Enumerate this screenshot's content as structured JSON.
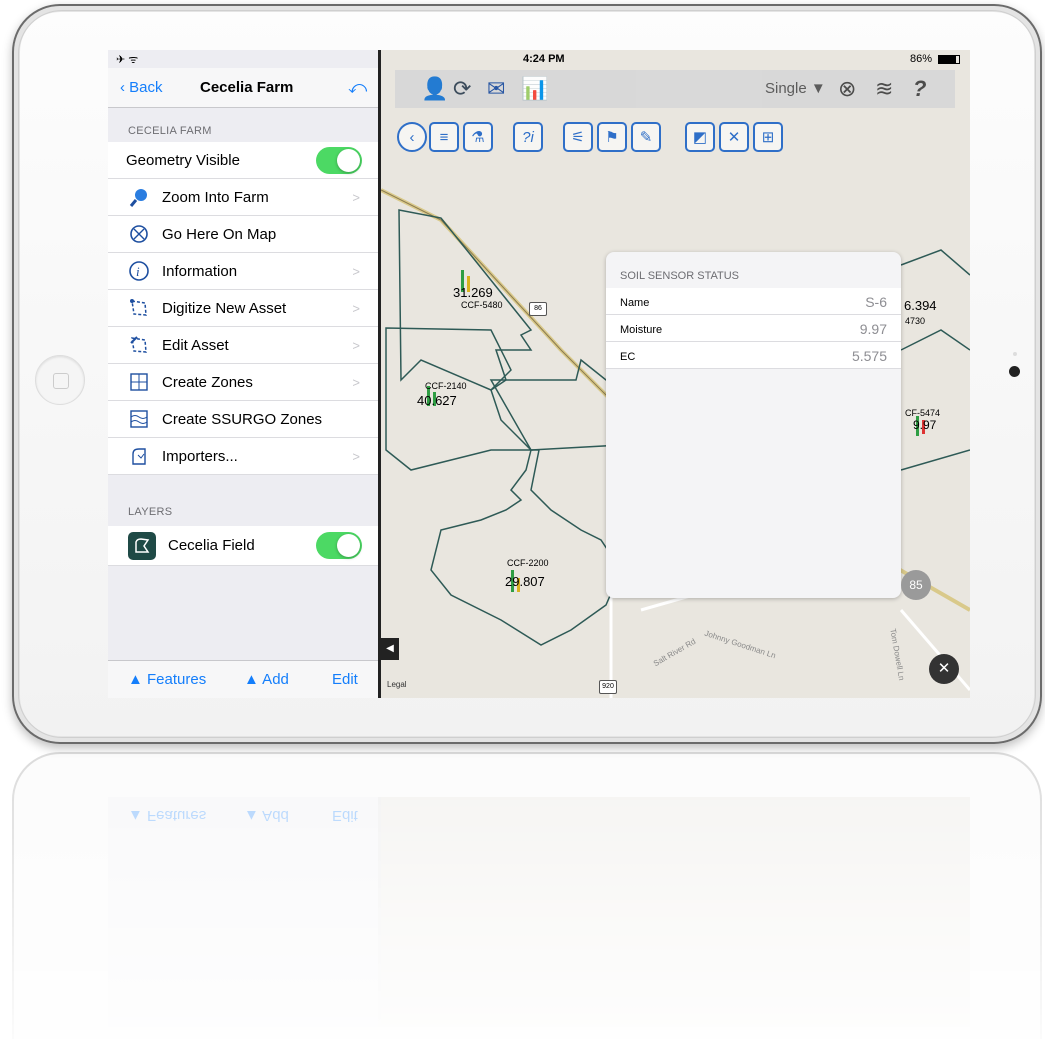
{
  "status_bar": {
    "left_icons": "✈ ᯤ",
    "time": "4:24 PM",
    "battery": "86%"
  },
  "nav": {
    "back_label": "Back",
    "title": "Cecelia Farm"
  },
  "sections": {
    "farm_header": "CECELIA FARM",
    "layers_header": "LAYERS"
  },
  "farm_items": [
    {
      "label": "Geometry Visible",
      "type": "toggle"
    },
    {
      "label": "Zoom Into Farm",
      "icon": "magnifier-icon"
    },
    {
      "label": "Go Here On Map",
      "icon": "compass-icon"
    },
    {
      "label": "Information",
      "icon": "info-icon"
    },
    {
      "label": "Digitize New Asset",
      "icon": "digitize-icon"
    },
    {
      "label": "Edit Asset",
      "icon": "edit-asset-icon"
    },
    {
      "label": "Create Zones",
      "icon": "grid-icon"
    },
    {
      "label": "Create SSURGO Zones",
      "icon": "ssurgo-icon"
    },
    {
      "label": "Importers...",
      "icon": "importer-icon"
    }
  ],
  "layers": [
    {
      "label": "Cecelia Field",
      "toggle": true
    }
  ],
  "bottom_bar": {
    "features": "▲ Features",
    "add": "▲ Add",
    "edit": "Edit"
  },
  "map_toolbar": {
    "mode": "Single ▼",
    "help": "?"
  },
  "popup": {
    "header": "SOIL SENSOR STATUS",
    "rows": [
      {
        "key": "Name",
        "value": "S-6"
      },
      {
        "key": "Moisture",
        "value": "9.97"
      },
      {
        "key": "EC",
        "value": "5.575"
      }
    ]
  },
  "map_labels": {
    "f1_value": "31.269",
    "f1_id": "CCF-5480",
    "f2_id": "CCF-2140",
    "f2_value": "40.627",
    "f3_id": "CCF-2200",
    "f3_value": "29.807",
    "f4_value": "6.394",
    "f4_id": "4730",
    "f5_id": "CF-5474",
    "f5_value": "9.97",
    "road1": "Salt River Rd",
    "road2": "Johnny Goodman Ln",
    "road3": "Tom Dowell Ln",
    "shield1": "86",
    "shield2": "920",
    "badge": "85",
    "legal": "Legal"
  },
  "colors": {
    "accent": "#147efb",
    "toggle_on": "#4cd964",
    "field_border": "#2e5a56"
  }
}
